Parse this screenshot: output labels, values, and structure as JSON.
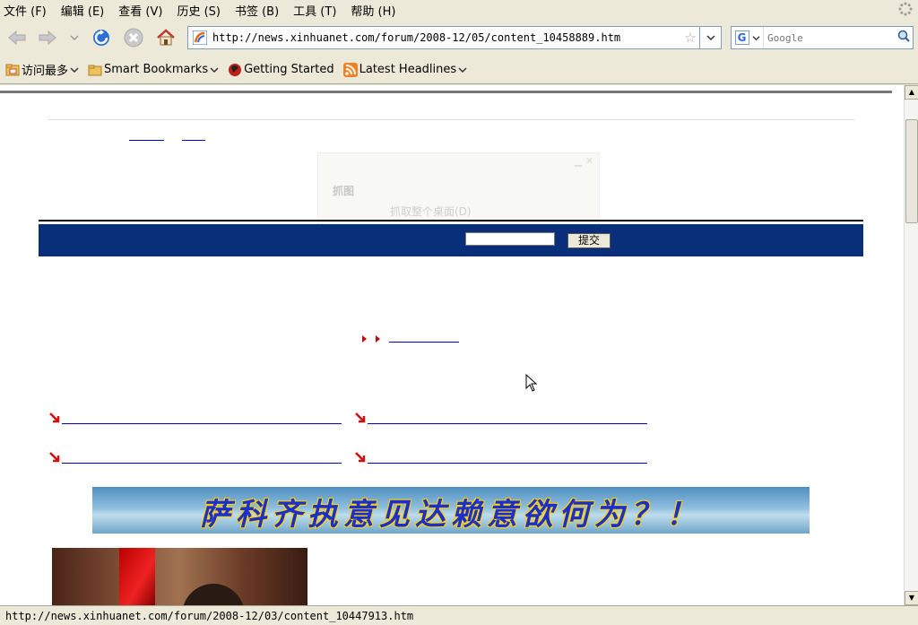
{
  "menu": {
    "items": [
      "文件 (F)",
      "编辑 (E)",
      "查看 (V)",
      "历史 (S)",
      "书签 (B)",
      "工具 (T)",
      "帮助 (H)"
    ]
  },
  "nav": {
    "url": "http://news.xinhuanet.com/forum/2008-12/05/content_10458889.htm",
    "search_placeholder": "Google",
    "icons": [
      "back-icon",
      "forward-icon",
      "history-dropdown-icon",
      "reload-icon",
      "stop-icon",
      "home-icon"
    ]
  },
  "bookmarks": {
    "items": [
      {
        "label": "访问最多",
        "icon": "folder-icon",
        "dropdown": true
      },
      {
        "label": "Smart Bookmarks",
        "icon": "folder-icon",
        "dropdown": true
      },
      {
        "label": "Getting Started",
        "icon": "firefox-icon",
        "dropdown": false
      },
      {
        "label": "Latest Headlines",
        "icon": "rss-icon",
        "dropdown": true
      }
    ]
  },
  "content": {
    "ghost_dialog": {
      "title": "抓图",
      "option": "抓取整个桌面(D)"
    },
    "search_bar": {
      "submit_label": "提交",
      "input_value": ""
    },
    "banner_text": "萨科齐执意见达赖意欲何为？！",
    "colors": {
      "navy_bar": "#0a2f7a",
      "link": "#0000cc",
      "arrow": "#cc0000"
    }
  },
  "status": {
    "text": "http://news.xinhuanet.com/forum/2008-12/03/content_10447913.htm"
  }
}
